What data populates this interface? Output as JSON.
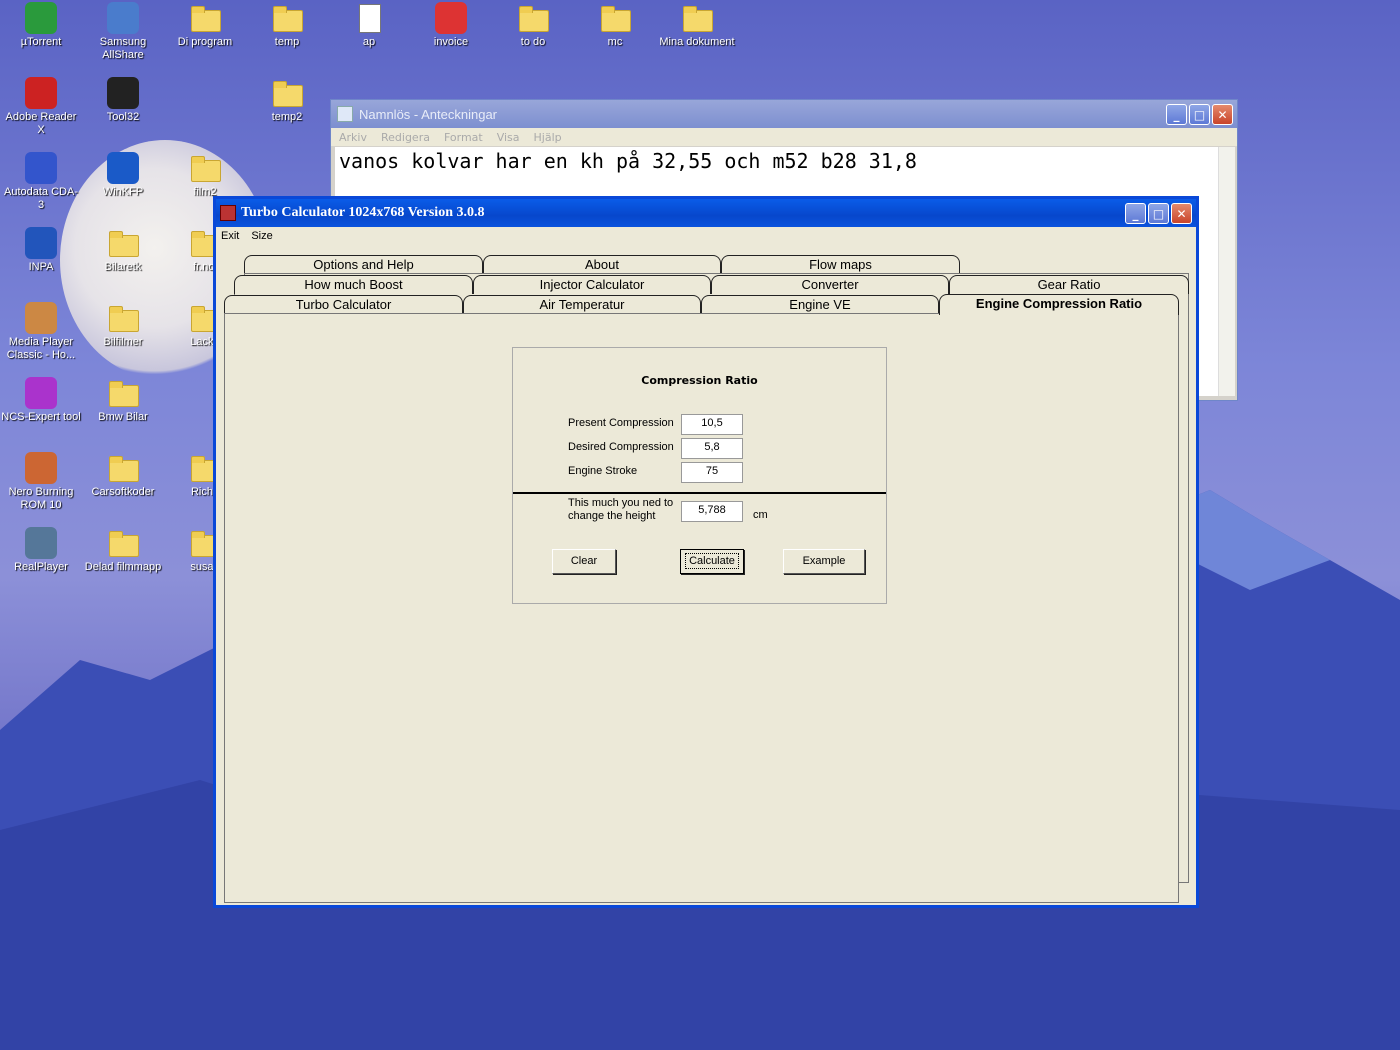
{
  "desktop": {
    "icons": [
      {
        "label": "µTorrent"
      },
      {
        "label": "Samsung AllShare"
      },
      {
        "label": "Di program"
      },
      {
        "label": "temp"
      },
      {
        "label": "ap"
      },
      {
        "label": "invoice"
      },
      {
        "label": "to do"
      },
      {
        "label": "mc"
      },
      {
        "label": "Mina dokument"
      },
      {
        "label": "Adobe Reader X"
      },
      {
        "label": "Tool32"
      },
      {
        "label": "temp2"
      },
      {
        "label": "Autodata CDA-3"
      },
      {
        "label": "WinKFP"
      },
      {
        "label": "film2"
      },
      {
        "label": "INPA"
      },
      {
        "label": "Bilaretk"
      },
      {
        "label": "fr.nol"
      },
      {
        "label": "Media Player Classic - Ho..."
      },
      {
        "label": "Bilfilmer"
      },
      {
        "label": "Lacke"
      },
      {
        "label": "NCS-Expert tool"
      },
      {
        "label": "Bmw Bilar"
      },
      {
        "label": "Nero Burning ROM 10"
      },
      {
        "label": "Carsoftkoder"
      },
      {
        "label": "Richa"
      },
      {
        "label": "RealPlayer"
      },
      {
        "label": "Delad filmmapp"
      },
      {
        "label": "susan"
      }
    ]
  },
  "notepad": {
    "title": "Namnlös - Anteckningar",
    "menu": [
      "Arkiv",
      "Redigera",
      "Format",
      "Visa",
      "Hjälp"
    ],
    "text": "vanos kolvar har en kh på 32,55 och m52 b28 31,8"
  },
  "app": {
    "title": "Turbo Calculator 1024x768 Version 3.0.8",
    "menu": {
      "exit": "Exit",
      "size": "Size"
    },
    "tabs": {
      "row1": [
        "Options and Help",
        "About",
        "Flow maps"
      ],
      "row2": [
        "How much Boost",
        "Injector Calculator",
        "Converter",
        "Gear Ratio"
      ],
      "row3": [
        "Turbo Calculator",
        "Air Temperatur",
        "Engine VE",
        "Engine Compression Ratio"
      ]
    },
    "compression": {
      "title": "Compression Ratio",
      "present_label": "Present Compression",
      "present_value": "10,5",
      "desired_label": "Desired Compression",
      "desired_value": "5,8",
      "stroke_label": "Engine Stroke",
      "stroke_value": "75",
      "result_label_1": "This much you ned to",
      "result_label_2": "change the height",
      "result_value": "5,788",
      "unit": "cm",
      "clear": "Clear",
      "calculate": "Calculate",
      "example": "Example"
    }
  }
}
